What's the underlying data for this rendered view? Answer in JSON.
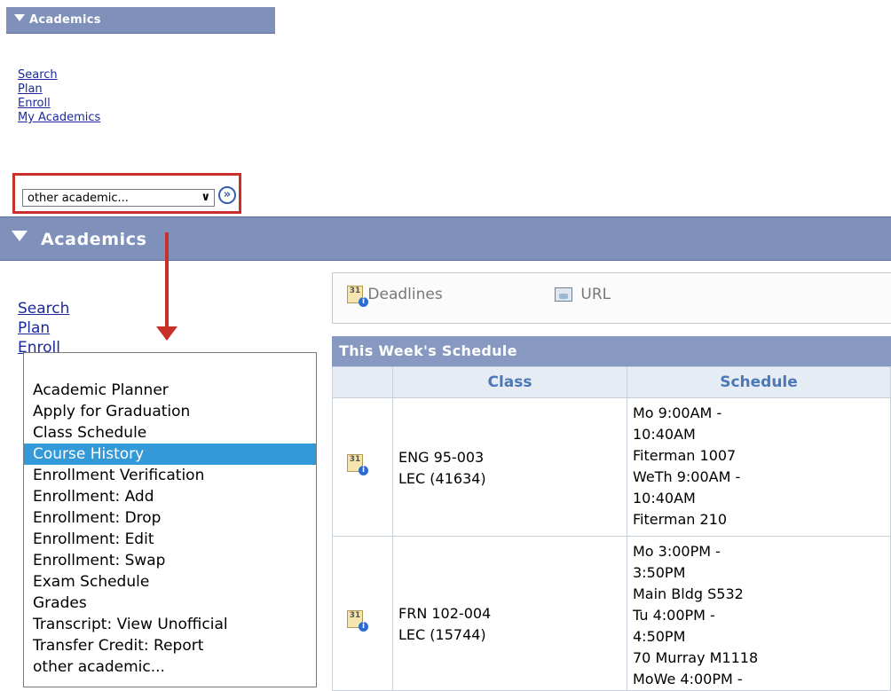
{
  "small_panel": {
    "title": "Academics",
    "links": [
      "Search",
      "Plan",
      "Enroll",
      "My Academics"
    ],
    "select_value": "other academic...",
    "go_label": "»"
  },
  "big_panel": {
    "title": "Academics",
    "links": [
      "Search",
      "Plan",
      "Enroll"
    ]
  },
  "dropdown": {
    "options": [
      "Academic Planner",
      "Apply for Graduation",
      "Class Schedule",
      "Course History",
      "Enrollment Verification",
      "Enrollment: Add",
      "Enrollment: Drop",
      "Enrollment: Edit",
      "Enrollment: Swap",
      "Exam Schedule",
      "Grades",
      "Transcript: View Unofficial",
      "Transfer Credit: Report",
      "other academic..."
    ],
    "selected": "Course History"
  },
  "toolbar": {
    "deadlines_label": "Deadlines",
    "url_label": "URL"
  },
  "schedule": {
    "title": "This Week's Schedule",
    "columns": [
      "Class",
      "Schedule"
    ],
    "rows": [
      {
        "class_lines": [
          "ENG 95-003",
          "LEC (41634)"
        ],
        "schedule_lines": [
          "Mo 9:00AM -",
          "10:40AM",
          "Fiterman 1007",
          "WeTh 9:00AM -",
          "10:40AM",
          "Fiterman 210"
        ]
      },
      {
        "class_lines": [
          "FRN 102-004",
          "LEC (15744)"
        ],
        "schedule_lines": [
          "Mo 3:00PM -",
          "3:50PM",
          "Main Bldg S532",
          "Tu 4:00PM -",
          "4:50PM",
          "70 Murray M1118",
          "MoWe 4:00PM -"
        ]
      }
    ]
  },
  "colors": {
    "header_bg": "#7f91ba",
    "highlight_red": "#c9302c",
    "selected_option_bg": "#3399d9",
    "link": "#1a2a9a"
  }
}
